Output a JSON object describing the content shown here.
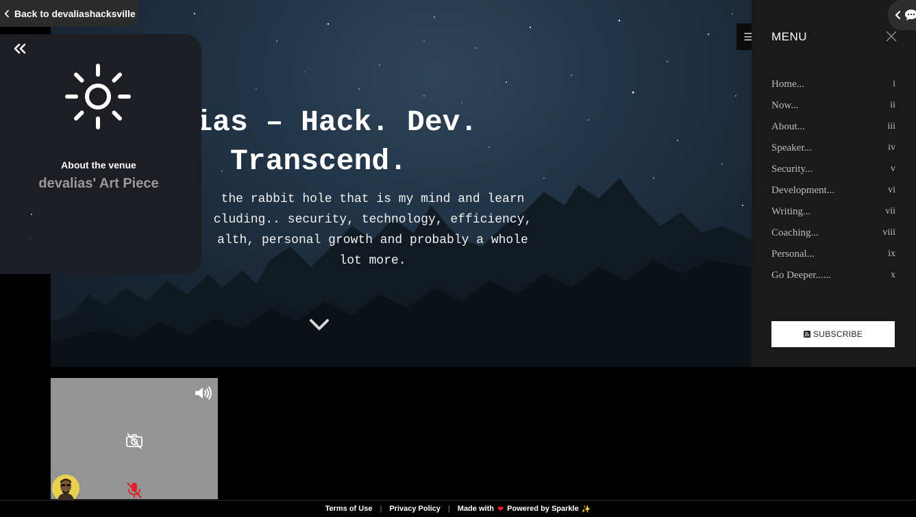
{
  "back_button": {
    "label": "Back to devaliashacksville"
  },
  "venue": {
    "label": "About the venue",
    "name": "devalias' Art Piece",
    "dots": [
      ".",
      "."
    ]
  },
  "hero": {
    "title_lines": [
      "alias – Hack. Dev.",
      "Transcend."
    ],
    "subtitle_lines": [
      "the rabbit hole that is my mind and learn",
      "cluding.. security, technology, efficiency,",
      "alth, personal growth and probably a whole",
      "lot more."
    ]
  },
  "menu": {
    "title": "MENU",
    "items": [
      {
        "label": "Home...",
        "num": "i"
      },
      {
        "label": "Now...",
        "num": "ii"
      },
      {
        "label": "About...",
        "num": "iii"
      },
      {
        "label": "Speaker...",
        "num": "iv"
      },
      {
        "label": "Security...",
        "num": "v"
      },
      {
        "label": "Development...",
        "num": "vi"
      },
      {
        "label": "Writing...",
        "num": "vii"
      },
      {
        "label": "Coaching...",
        "num": "viii"
      },
      {
        "label": "Personal...",
        "num": "ix"
      },
      {
        "label": "Go Deeper......",
        "num": "x"
      }
    ],
    "subscribe_label": "SUBSCRIBE"
  },
  "footer": {
    "terms": "Terms of Use",
    "privacy": "Privacy Policy",
    "made_with": "Made with",
    "powered_by": "Powered by Sparkle"
  },
  "colors": {
    "menu_bg": "#1a1a1a",
    "venue_card_bg": "#1d1d24",
    "muted_mic": "#e0202a"
  }
}
